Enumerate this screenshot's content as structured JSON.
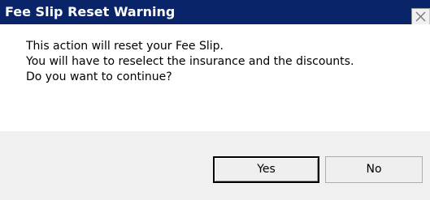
{
  "window": {
    "title": "Fee Slip Reset Warning"
  },
  "message": {
    "lines": [
      "This action will reset your Fee Slip.",
      "You will have to reselect the insurance and the discounts.",
      "Do you want to continue?"
    ]
  },
  "buttons": {
    "yes_label": "Yes",
    "no_label": "No"
  },
  "icons": {
    "close": "close-icon"
  },
  "colors": {
    "titlebar": "#0a246a",
    "title_text": "#ffffff",
    "content_background": "#ffffff",
    "footer_background": "#f0f0f0"
  }
}
